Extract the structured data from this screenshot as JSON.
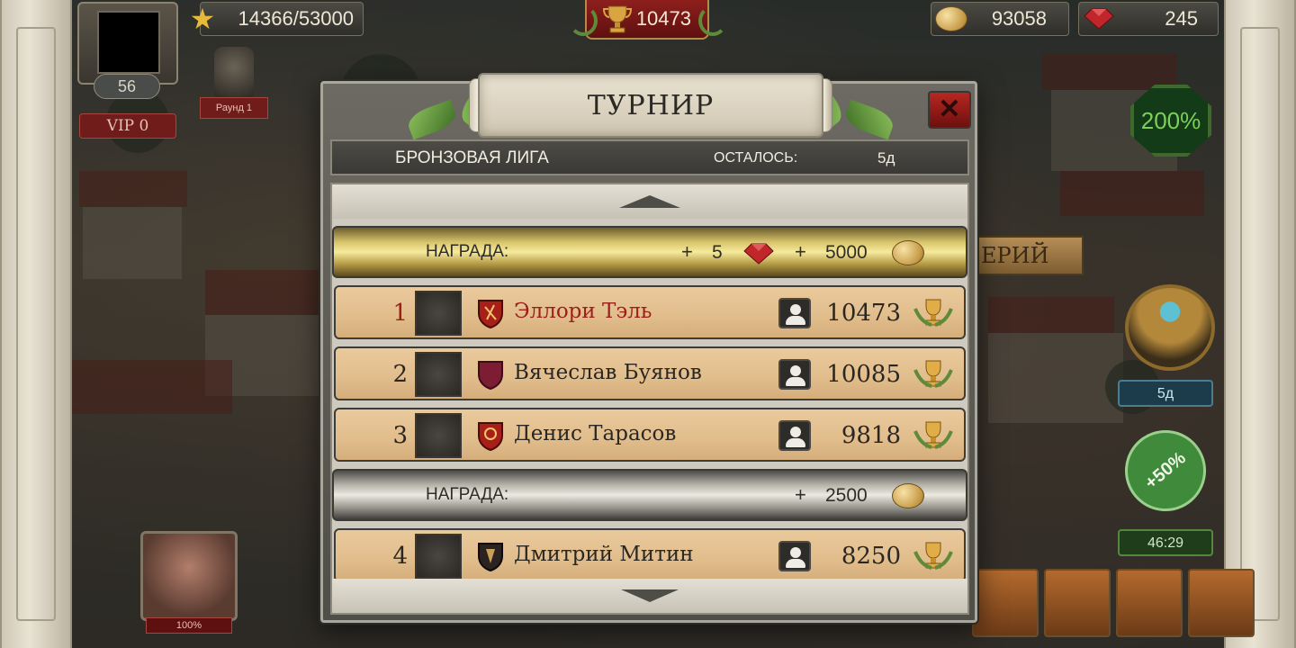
{
  "hud": {
    "level": "56",
    "vip": "VIP 0",
    "round_label": "Раунд 1",
    "xp": "14366/53000",
    "trophies": "10473",
    "coins": "93058",
    "gems": "245"
  },
  "side": {
    "bonus_percent": "200%",
    "timer_small": "5д",
    "discount": "+50%",
    "timer": "46:29",
    "boss_hp": "100%",
    "ribbon_partial": "ЕРИЙ"
  },
  "dialog": {
    "title": "ТУРНИР",
    "league": "БРОНЗОВАЯ ЛИГА",
    "remaining_label": "ОСТАЛОСЬ:",
    "remaining_value": "5д",
    "reward_gold": {
      "label": "НАГРАДА:",
      "plus1": "+",
      "gems": "5",
      "plus2": "+",
      "coins": "5000"
    },
    "reward_silver": {
      "label": "НАГРАДА:",
      "plus": "+",
      "coins": "2500"
    },
    "players": [
      {
        "rank": "1",
        "name": "Эллори Тэль",
        "score": "10473"
      },
      {
        "rank": "2",
        "name": "Вячеслав Буянов",
        "score": "10085"
      },
      {
        "rank": "3",
        "name": "Денис Тарасов",
        "score": "9818"
      },
      {
        "rank": "4",
        "name": "Дмитрий Митин",
        "score": "8250"
      }
    ]
  },
  "colors": {
    "gold_row": "#d9c56c",
    "silver_row": "#ebe9e0",
    "player_row": "#e1bd8c",
    "leader_red": "#9b1f1a",
    "close_red": "#b72722"
  }
}
